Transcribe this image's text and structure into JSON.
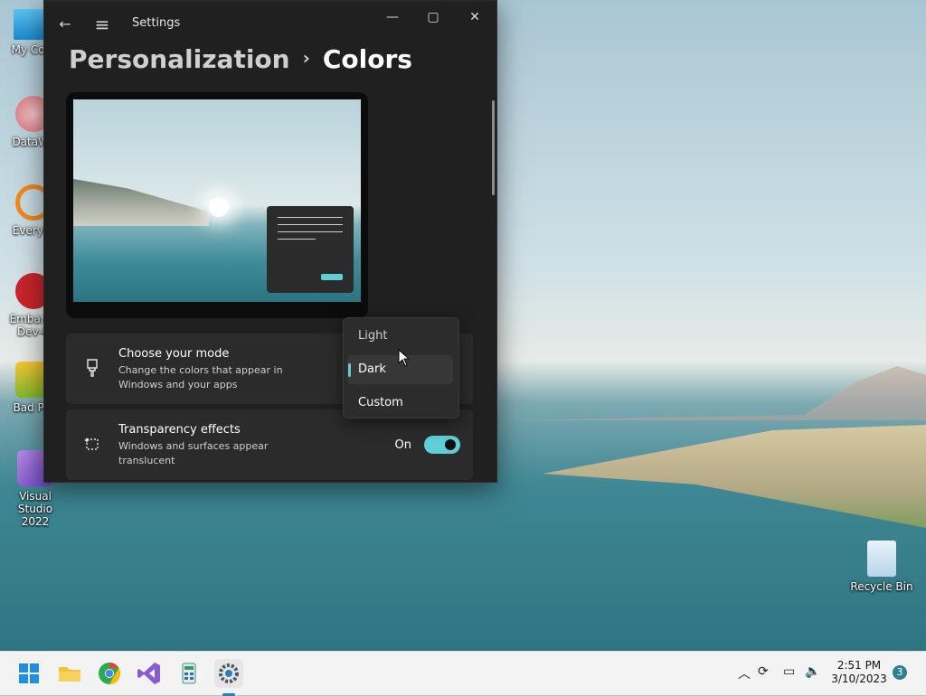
{
  "window": {
    "title": "Settings",
    "back_icon": "←",
    "menu_icon": "≡",
    "controls": {
      "minimize": "—",
      "maximize": "▢",
      "close": "✕"
    }
  },
  "breadcrumb": {
    "parent": "Personalization",
    "separator": "›",
    "current": "Colors"
  },
  "mode_card": {
    "title": "Choose your mode",
    "description": "Change the colors that appear in Windows and your apps",
    "icon": "paintbrush-icon"
  },
  "mode_dropdown": {
    "options": [
      "Light",
      "Dark",
      "Custom"
    ],
    "selected": "Dark"
  },
  "transparency_card": {
    "title": "Transparency effects",
    "description": "Windows and surfaces appear translucent",
    "state_label": "On",
    "enabled": true
  },
  "desktop_icons": [
    {
      "label": "My Com",
      "icon": "computer-icon"
    },
    {
      "label": "DataWa",
      "icon": "datawarehouse-icon"
    },
    {
      "label": "Everyth",
      "icon": "everything-search-icon"
    },
    {
      "label": "Embarca",
      "label2": "Dev-C",
      "icon": "devcpp-icon"
    },
    {
      "label": "Bad Pig",
      "icon": "bad-piggies-icon"
    },
    {
      "label": "Visual Studio",
      "label2": "2022",
      "icon": "visual-studio-icon"
    },
    {
      "label": "Recycle Bin",
      "icon": "recycle-bin-icon"
    }
  ],
  "taskbar": {
    "apps": [
      "start-icon",
      "file-explorer-icon",
      "chrome-icon",
      "visual-studio-icon",
      "calculator-icon",
      "settings-icon"
    ],
    "clock_time": "2:51 PM",
    "clock_date": "3/10/2023",
    "notification_count": "3"
  },
  "colors": {
    "accent": "#5fcfd6",
    "window_bg": "#202020",
    "card_bg": "#2b2b2b"
  }
}
